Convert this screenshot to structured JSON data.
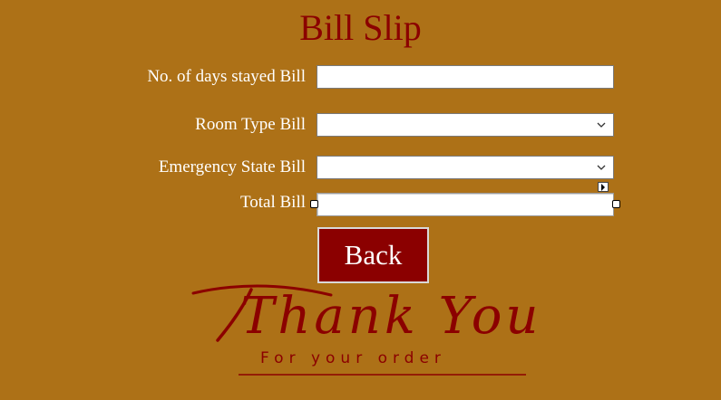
{
  "page": {
    "title": "Bill Slip"
  },
  "form": {
    "days_label": "No. of days stayed Bill",
    "days_value": "",
    "room_label": "Room Type Bill",
    "room_value": "",
    "emergency_label": "Emergency State Bill",
    "emergency_value": "",
    "total_label": "Total Bill",
    "total_value": ""
  },
  "actions": {
    "back_label": "Back"
  },
  "thank_you": {
    "headline": "Thank You",
    "subline": "For your order"
  },
  "icons": {
    "dropdown": "chevron-down-icon",
    "smart_tag": "smart-tag-arrow-icon",
    "resize": "resize-handle-icon"
  },
  "colors": {
    "background": "#ad7117",
    "accent": "#8b0000",
    "label_text": "#ffffff"
  }
}
